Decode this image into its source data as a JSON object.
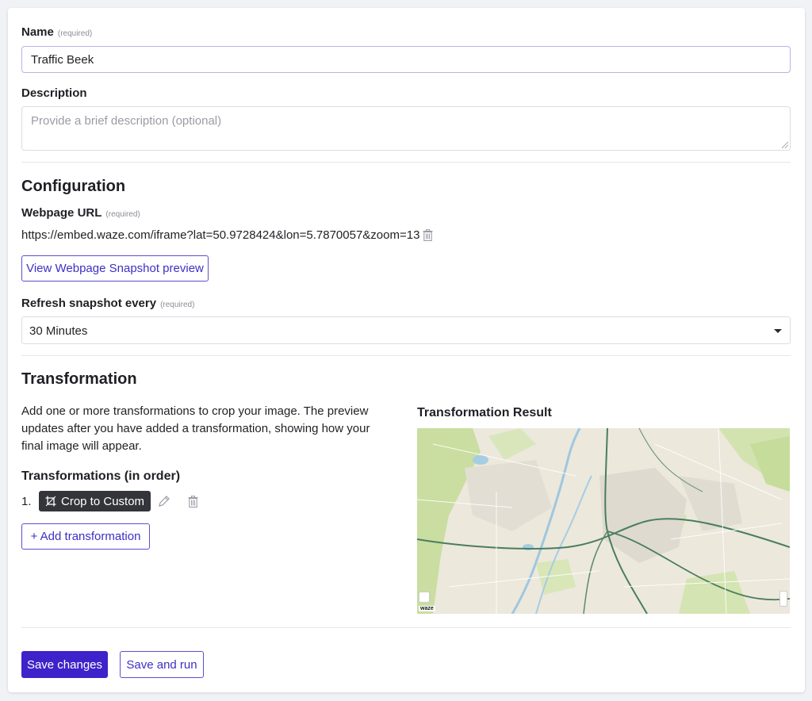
{
  "form": {
    "name_label": "Name",
    "name_required": "(required)",
    "name_value": "Traffic Beek",
    "description_label": "Description",
    "description_placeholder": "Provide a brief description (optional)"
  },
  "configuration": {
    "heading": "Configuration",
    "url_label": "Webpage URL",
    "url_required": "(required)",
    "url_value": "https://embed.waze.com/iframe?lat=50.9728424&lon=5.7870057&zoom=13",
    "preview_button": "View Webpage Snapshot preview",
    "refresh_label": "Refresh snapshot every",
    "refresh_required": "(required)",
    "refresh_value": "30 Minutes"
  },
  "transformation": {
    "heading": "Transformation",
    "intro": "Add one or more transformations to crop your image. The preview updates after you have added a transformation, showing how your final image will appear.",
    "list_heading": "Transformations (in order)",
    "items": [
      {
        "index": "1.",
        "label": "Crop to Custom"
      }
    ],
    "add_button": "+ Add transformation",
    "result_heading": "Transformation Result",
    "map_brand": "waze"
  },
  "actions": {
    "save": "Save changes",
    "save_run": "Save and run"
  },
  "colors": {
    "accent": "#3d23c9",
    "accent_text": "#3d2fc4",
    "chip_bg": "#34353a"
  },
  "icons": {
    "crop": "crop-icon",
    "edit": "pencil-icon",
    "delete": "trash-icon"
  }
}
